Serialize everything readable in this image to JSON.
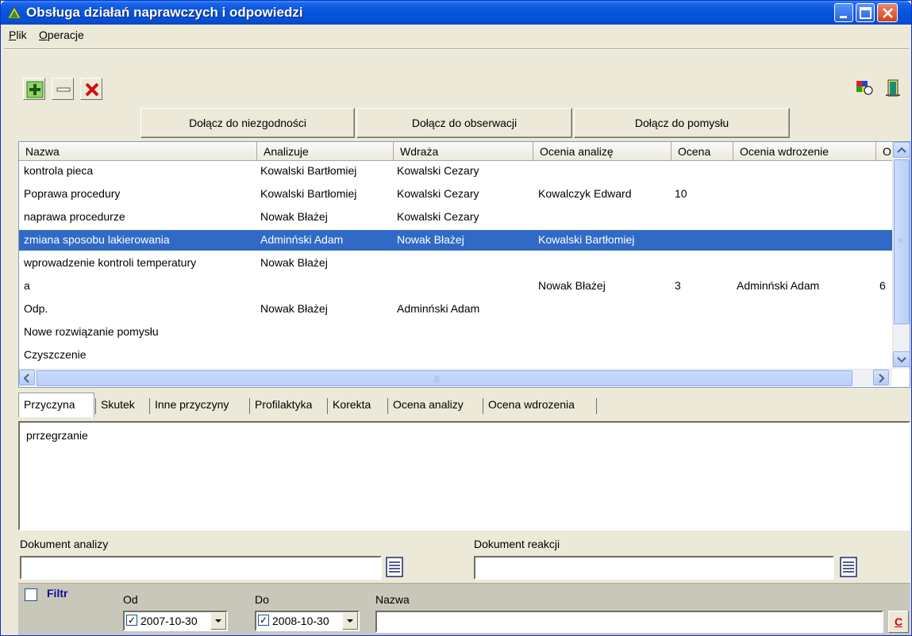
{
  "window": {
    "title": "Obsługa działań naprawczych i odpowiedzi"
  },
  "menu": [
    {
      "label": "Plik",
      "mnemonic": "P"
    },
    {
      "label": "Operacje",
      "mnemonic": "O"
    }
  ],
  "toolbar": {
    "icons": [
      "add-icon",
      "remove-icon",
      "delete-icon",
      "colors-icon",
      "exit-door-icon"
    ]
  },
  "attach_buttons": [
    "Dołącz do niezgodności",
    "Dołącz do obserwacji",
    "Dołącz do pomysłu"
  ],
  "grid": {
    "columns": [
      "Nazwa",
      "Analizuje",
      "Wdraża",
      "Ocenia analizę",
      "Ocena",
      "Ocenia wdrozenie",
      "O"
    ],
    "rows": [
      [
        "kontrola pieca",
        "Kowalski Bartłomiej",
        "Kowalski Cezary",
        "",
        "",
        "",
        ""
      ],
      [
        "Poprawa procedury",
        "Kowalski Bartłomiej",
        "Kowalski Cezary",
        "Kowalczyk Edward",
        "10",
        "",
        ""
      ],
      [
        "naprawa procedurze",
        "Nowak Błażej",
        "Kowalski Cezary",
        "",
        "",
        "",
        ""
      ],
      [
        "zmiana sposobu lakierowania",
        "Adminński Adam",
        "Nowak Błażej",
        "Kowalski Bartłomiej",
        "",
        "",
        ""
      ],
      [
        "wprowadzenie kontroli temperatury",
        "Nowak Błażej",
        "",
        "",
        "",
        "",
        ""
      ],
      [
        "a",
        "",
        "",
        "Nowak Błażej",
        "3",
        "Adminński Adam",
        "6"
      ],
      [
        "Odp.",
        "Nowak Błażej",
        "Adminński Adam",
        "",
        "",
        "",
        ""
      ],
      [
        "Nowe rozwiązanie pomysłu",
        "",
        "",
        "",
        "",
        "",
        ""
      ],
      [
        "Czyszczenie",
        "",
        "",
        "",
        "",
        "",
        ""
      ]
    ],
    "selected_row": 3,
    "selection_color": "#316ac5"
  },
  "tabs": [
    "Przyczyna",
    "Skutek",
    "Inne przyczyny",
    "Profilaktyka",
    "Korekta",
    "Ocena analizy",
    "Ocena wdrozenia"
  ],
  "active_tab": "Przyczyna",
  "memo_text": "prrzegrzanie",
  "documents": {
    "analysis_label": "Dokument analizy",
    "analysis_value": "",
    "reaction_label": "Dokument reakcji",
    "reaction_value": ""
  },
  "filter": {
    "label": "Filtr",
    "checked": false,
    "from_label": "Od",
    "from_value": "2007-10-30",
    "from_checked": true,
    "to_label": "Do",
    "to_value": "2008-10-30",
    "to_checked": true,
    "name_label": "Nazwa",
    "name_value": "",
    "clear_label": "C"
  }
}
